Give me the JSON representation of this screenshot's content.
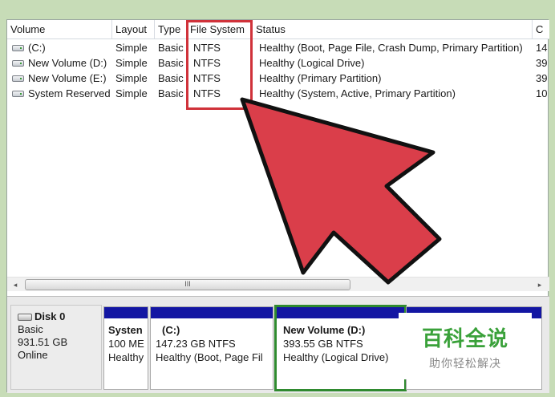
{
  "columns": {
    "volume": "Volume",
    "layout": "Layout",
    "type": "Type",
    "file_system": "File System",
    "status": "Status",
    "capacity": "C"
  },
  "volumes": [
    {
      "name": "(C:)",
      "layout": "Simple",
      "type": "Basic",
      "fs": "NTFS",
      "status": "Healthy (Boot, Page File, Crash Dump, Primary Partition)",
      "cap": "14"
    },
    {
      "name": "New Volume (D:)",
      "layout": "Simple",
      "type": "Basic",
      "fs": "NTFS",
      "status": "Healthy (Logical Drive)",
      "cap": "39"
    },
    {
      "name": "New Volume (E:)",
      "layout": "Simple",
      "type": "Basic",
      "fs": "NTFS",
      "status": "Healthy (Primary Partition)",
      "cap": "39"
    },
    {
      "name": "System Reserved",
      "layout": "Simple",
      "type": "Basic",
      "fs": "NTFS",
      "status": "Healthy (System, Active, Primary Partition)",
      "cap": "10"
    }
  ],
  "scrollbar": {
    "left_arrow": "◂",
    "right_arrow": "▸",
    "grip": "III"
  },
  "disk": {
    "name": "Disk 0",
    "type": "Basic",
    "size": "931.51 GB",
    "state": "Online"
  },
  "partitions": [
    {
      "title": "Systen",
      "line1": "100 ME",
      "line2": "Healthy"
    },
    {
      "title": "(C:)",
      "line1": "147.23 GB NTFS",
      "line2": "Healthy (Boot, Page Fil"
    },
    {
      "title": "New Volume  (D:)",
      "line1": "393.55 GB NTFS",
      "line2": "Healthy (Logical Drive)"
    }
  ],
  "watermark": {
    "title": "百科全说",
    "subtitle": "助你轻松解决"
  },
  "colors": {
    "highlight": "#d0323a",
    "partition_bar": "#1316a3",
    "selected_border": "#2f8a2f",
    "watermark": "#3aa13a"
  }
}
